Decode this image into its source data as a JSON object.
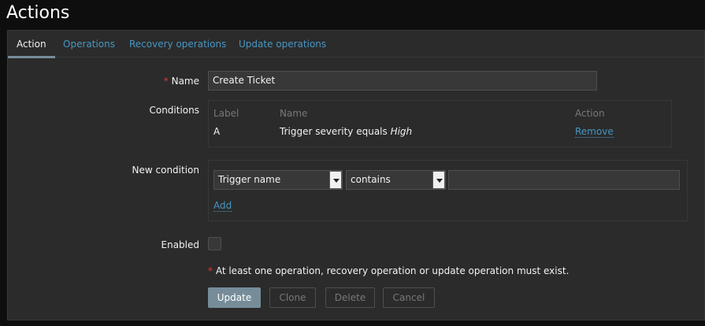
{
  "page_title": "Actions",
  "tabs": [
    {
      "label": "Action"
    },
    {
      "label": "Operations"
    },
    {
      "label": "Recovery operations"
    },
    {
      "label": "Update operations"
    }
  ],
  "form": {
    "name_label": "Name",
    "required_mark": "*",
    "name_value": "Create Ticket",
    "conditions_label": "Conditions",
    "conditions_headers": {
      "label": "Label",
      "name": "Name",
      "action": "Action"
    },
    "conditions": [
      {
        "label": "A",
        "name_prefix": "Trigger severity equals ",
        "name_value": "High",
        "action": "Remove"
      }
    ],
    "new_condition_label": "New condition",
    "new_condition": {
      "type": "Trigger name",
      "operator": "contains",
      "value": "",
      "add": "Add"
    },
    "enabled_label": "Enabled",
    "enabled": false,
    "note": "At least one operation, recovery operation or update operation must exist."
  },
  "buttons": {
    "update": "Update",
    "clone": "Clone",
    "delete": "Delete",
    "cancel": "Cancel"
  }
}
